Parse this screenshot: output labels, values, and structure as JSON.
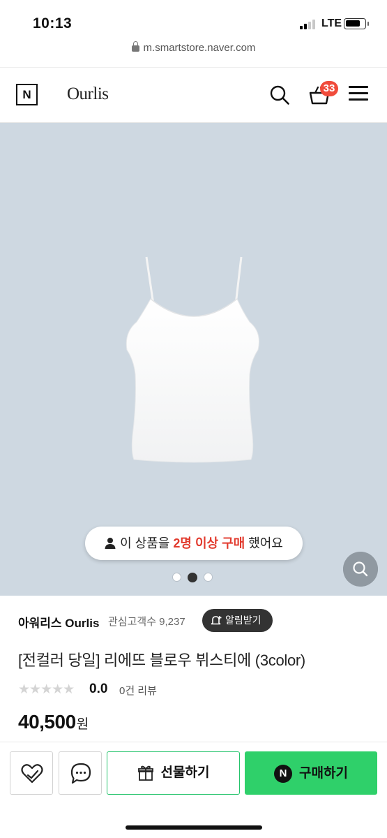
{
  "status_bar": {
    "time": "10:13",
    "network": "LTE",
    "battery_level": 0.75
  },
  "browser": {
    "url": "m.smartstore.naver.com"
  },
  "header": {
    "n_logo": "N",
    "brand": "Ourlis",
    "cart_count": "33",
    "icons": [
      "search-icon",
      "cart-icon",
      "menu-icon"
    ]
  },
  "gallery": {
    "purchase_notice": {
      "prefix": "이 상품을 ",
      "highlight": "2명 이상 구매",
      "suffix": " 했어요"
    },
    "page_count": 3,
    "active_page": 2,
    "background_color": "#ced8e1"
  },
  "store": {
    "name": "아워리스 Ourlis",
    "followers": "관심고객수 9,237",
    "alarm_label": "알림받기"
  },
  "product": {
    "title": "[전컬러 당일] 리에뜨 블로우 뷔스티에 (3color)",
    "stars": "★★★★★",
    "rating": "0.0",
    "review_count": "0건 리뷰",
    "price": "40,500",
    "currency": "원"
  },
  "bottom_bar": {
    "gift_label": "선물하기",
    "buy_label": "구매하기",
    "npay_mark": "N",
    "accent_color": "#2fd06a"
  }
}
